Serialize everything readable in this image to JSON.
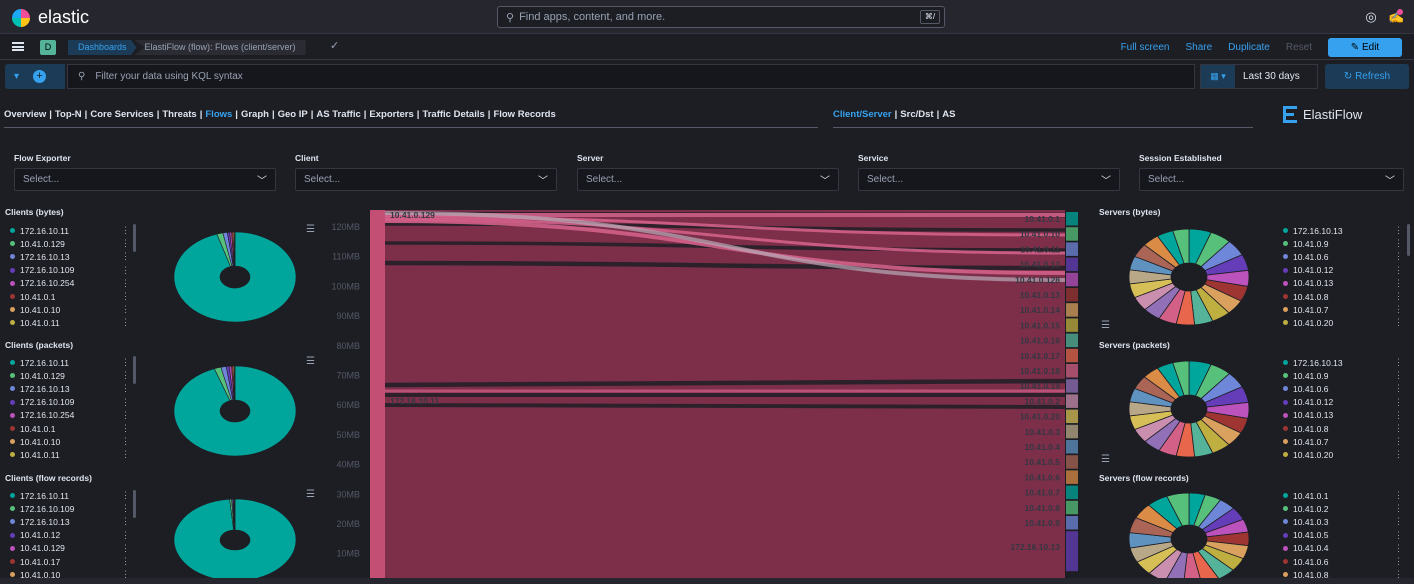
{
  "header": {
    "app_name": "elastic",
    "search_placeholder": "Find apps, content, and more.",
    "search_shortcut": "⌘/"
  },
  "nav": {
    "space_initial": "D",
    "breadcrumbs": [
      "Dashboards",
      "ElastiFlow (flow): Flows (client/server)"
    ],
    "actions": [
      "Full screen",
      "Share",
      "Duplicate",
      "Reset"
    ],
    "edit_label": "Edit"
  },
  "query": {
    "placeholder": "Filter your data using KQL syntax",
    "date_range": "Last 30 days",
    "refresh_label": "Refresh"
  },
  "tabs": {
    "main": [
      "Overview",
      "Top-N",
      "Core Services",
      "Threats",
      "Flows",
      "Graph",
      "Geo IP",
      "AS Traffic",
      "Exporters",
      "Traffic Details",
      "Flow Records"
    ],
    "main_active": "Flows",
    "sub": [
      "Client/Server",
      "Src/Dst",
      "AS"
    ],
    "sub_active": "Client/Server",
    "brand": "ElastiFlow"
  },
  "controls": [
    {
      "label": "Flow Exporter",
      "value": "Select..."
    },
    {
      "label": "Client",
      "value": "Select..."
    },
    {
      "label": "Server",
      "value": "Select..."
    },
    {
      "label": "Service",
      "value": "Select..."
    },
    {
      "label": "Session Established",
      "value": "Select..."
    }
  ],
  "clients_bytes": {
    "title": "Clients (bytes)",
    "items": [
      {
        "label": "172.16.10.11",
        "color": "#00a69b"
      },
      {
        "label": "10.41.0.129",
        "color": "#57c17b"
      },
      {
        "label": "172.16.10.13",
        "color": "#6f87d8"
      },
      {
        "label": "172.16.10.109",
        "color": "#663db8"
      },
      {
        "label": "172.16.10.254",
        "color": "#bc52bc"
      },
      {
        "label": "10.41.0.1",
        "color": "#9e3533"
      },
      {
        "label": "10.41.0.10",
        "color": "#daa05d"
      },
      {
        "label": "10.41.0.11",
        "color": "#bfaf40"
      }
    ]
  },
  "clients_packets": {
    "title": "Clients (packets)",
    "items": [
      {
        "label": "172.16.10.11",
        "color": "#00a69b"
      },
      {
        "label": "10.41.0.129",
        "color": "#57c17b"
      },
      {
        "label": "172.16.10.13",
        "color": "#6f87d8"
      },
      {
        "label": "172.16.10.109",
        "color": "#663db8"
      },
      {
        "label": "172.16.10.254",
        "color": "#bc52bc"
      },
      {
        "label": "10.41.0.1",
        "color": "#9e3533"
      },
      {
        "label": "10.41.0.10",
        "color": "#daa05d"
      },
      {
        "label": "10.41.0.11",
        "color": "#bfaf40"
      }
    ]
  },
  "clients_flows": {
    "title": "Clients (flow records)",
    "items": [
      {
        "label": "172.16.10.11",
        "color": "#00a69b"
      },
      {
        "label": "172.16.10.109",
        "color": "#57c17b"
      },
      {
        "label": "172.16.10.13",
        "color": "#6f87d8"
      },
      {
        "label": "10.41.0.12",
        "color": "#663db8"
      },
      {
        "label": "10.41.0.129",
        "color": "#bc52bc"
      },
      {
        "label": "10.41.0.17",
        "color": "#9e3533"
      },
      {
        "label": "10.41.0.10",
        "color": "#daa05d"
      }
    ]
  },
  "servers_bytes": {
    "title": "Servers (bytes)",
    "items": [
      {
        "label": "172.16.10.13",
        "color": "#00a69b"
      },
      {
        "label": "10.41.0.9",
        "color": "#57c17b"
      },
      {
        "label": "10.41.0.6",
        "color": "#6f87d8"
      },
      {
        "label": "10.41.0.12",
        "color": "#663db8"
      },
      {
        "label": "10.41.0.13",
        "color": "#bc52bc"
      },
      {
        "label": "10.41.0.8",
        "color": "#9e3533"
      },
      {
        "label": "10.41.0.7",
        "color": "#daa05d"
      },
      {
        "label": "10.41.0.20",
        "color": "#bfaf40"
      }
    ]
  },
  "servers_packets": {
    "title": "Servers (packets)",
    "items": [
      {
        "label": "172.16.10.13",
        "color": "#00a69b"
      },
      {
        "label": "10.41.0.9",
        "color": "#57c17b"
      },
      {
        "label": "10.41.0.6",
        "color": "#6f87d8"
      },
      {
        "label": "10.41.0.12",
        "color": "#663db8"
      },
      {
        "label": "10.41.0.13",
        "color": "#bc52bc"
      },
      {
        "label": "10.41.0.8",
        "color": "#9e3533"
      },
      {
        "label": "10.41.0.7",
        "color": "#daa05d"
      },
      {
        "label": "10.41.0.20",
        "color": "#bfaf40"
      }
    ]
  },
  "servers_flows": {
    "title": "Servers (flow records)",
    "items": [
      {
        "label": "10.41.0.1",
        "color": "#00a69b"
      },
      {
        "label": "10.41.0.2",
        "color": "#57c17b"
      },
      {
        "label": "10.41.0.3",
        "color": "#6f87d8"
      },
      {
        "label": "10.41.0.5",
        "color": "#663db8"
      },
      {
        "label": "10.41.0.4",
        "color": "#bc52bc"
      },
      {
        "label": "10.41.0.6",
        "color": "#9e3533"
      },
      {
        "label": "10.41.0.8",
        "color": "#daa05d"
      }
    ]
  },
  "server_pie_colors": [
    "#00a69b",
    "#57c17b",
    "#6f87d8",
    "#663db8",
    "#bc52bc",
    "#9e3533",
    "#daa05d",
    "#bfaf40",
    "#54b399",
    "#e7664c",
    "#d36086",
    "#9170b8",
    "#ca8eae",
    "#d6bf57",
    "#b9a888",
    "#6092c0",
    "#aa6556",
    "#da8b45"
  ],
  "sankey": {
    "axis_ticks": [
      "120MB",
      "110MB",
      "100MB",
      "90MB",
      "80MB",
      "70MB",
      "60MB",
      "50MB",
      "40MB",
      "30MB",
      "20MB",
      "10MB"
    ],
    "source_labels": [
      "10.41.0.129",
      "172.16.10.11"
    ],
    "target_labels": [
      "10.41.0.1",
      "10.41.0.10",
      "10.41.0.11",
      "10.41.0.12",
      "10.41.0.128",
      "10.41.0.13",
      "10.41.0.14",
      "10.41.0.15",
      "10.41.0.16",
      "10.41.0.17",
      "10.41.0.18",
      "10.41.0.19",
      "10.41.0.2",
      "10.41.0.20",
      "10.41.0.3",
      "10.41.0.4",
      "10.41.0.5",
      "10.41.0.6",
      "10.41.0.7",
      "10.41.0.8",
      "10.41.0.9",
      "172.16.10.13"
    ],
    "colors": {
      "flow": "#7d2f4a",
      "band": "#d3608a",
      "bar": "#c44f74"
    },
    "target_colors": [
      "#00a69b",
      "#57c17b",
      "#6f87d8",
      "#663db8",
      "#bc52bc",
      "#9e3533",
      "#daa05d",
      "#bfaf40",
      "#54b399",
      "#e7664c",
      "#d36086",
      "#9170b8",
      "#ca8eae",
      "#d6bf57",
      "#b9a888",
      "#6092c0",
      "#aa6556",
      "#da8b45",
      "#00a69b",
      "#57c17b",
      "#6f87d8",
      "#663db8"
    ]
  }
}
